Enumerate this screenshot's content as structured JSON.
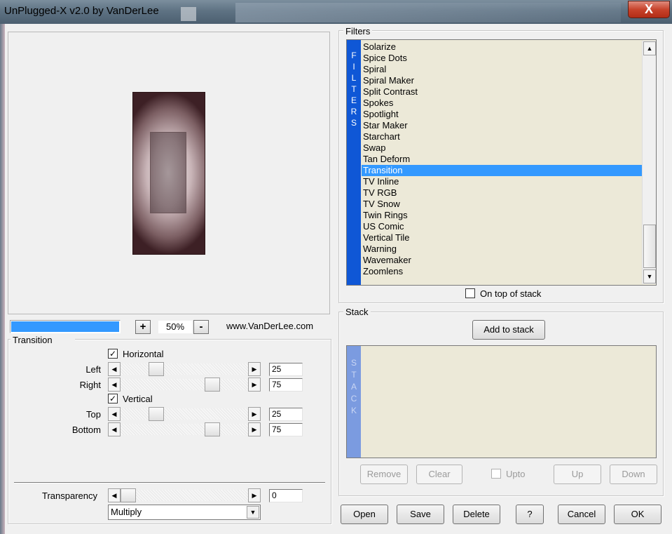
{
  "window": {
    "title": "UnPlugged-X v2.0 by VanDerLee",
    "close_symbol": "X"
  },
  "preview": {
    "zoom_level": "50%",
    "zoom_in": "+",
    "zoom_out": "-",
    "website": "www.VanDerLee.com",
    "progress": 1.0
  },
  "transition": {
    "group_label": "Transition",
    "horizontal": {
      "label": "Horizontal",
      "checked": true
    },
    "vertical": {
      "label": "Vertical",
      "checked": true
    },
    "sliders": [
      {
        "label": "Left",
        "value": "25"
      },
      {
        "label": "Right",
        "value": "75"
      },
      {
        "label": "Top",
        "value": "25"
      },
      {
        "label": "Bottom",
        "value": "75"
      }
    ],
    "transparency": {
      "label": "Transparency",
      "value": "0"
    },
    "blend_mode": "Multiply"
  },
  "filters": {
    "group_label": "Filters",
    "strip_letters": [
      "F",
      "I",
      "L",
      "T",
      "E",
      "R",
      "S"
    ],
    "items": [
      "Solarize",
      "Spice Dots",
      "Spiral",
      "Spiral Maker",
      "Split Contrast",
      "Spokes",
      "Spotlight",
      "Star Maker",
      "Starchart",
      "Swap",
      "Tan Deform",
      "Transition",
      "TV Inline",
      "TV RGB",
      "TV Snow",
      "Twin Rings",
      "US Comic",
      "Vertical Tile",
      "Warning",
      "Wavemaker",
      "Zoomlens"
    ],
    "selected": "Transition",
    "on_top_label": "On top of stack"
  },
  "stack": {
    "group_label": "Stack",
    "add_button": "Add to stack",
    "strip_letters": [
      "S",
      "T",
      "A",
      "C",
      "K"
    ],
    "remove": "Remove",
    "clear": "Clear",
    "upto": "Upto",
    "up": "Up",
    "down": "Down"
  },
  "bottom_buttons": {
    "open": "Open",
    "save": "Save",
    "delete": "Delete",
    "help": "?",
    "cancel": "Cancel",
    "ok": "OK"
  },
  "colors": {
    "selection": "#3399ff",
    "filter_strip": "#0f57d6",
    "stack_strip": "#7b9be0",
    "list_bg": "#ece9d8"
  }
}
